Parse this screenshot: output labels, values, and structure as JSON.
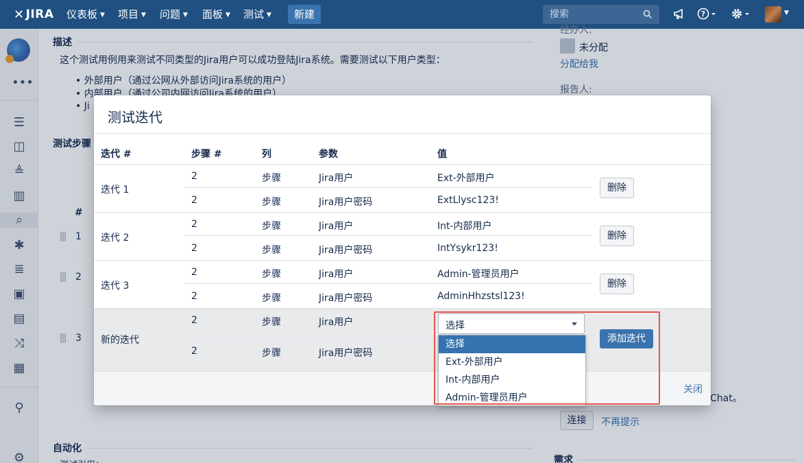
{
  "topnav": {
    "logo": "JIRA",
    "items": [
      {
        "label": "仪表板"
      },
      {
        "label": "项目"
      },
      {
        "label": "问题"
      },
      {
        "label": "面板"
      },
      {
        "label": "测试"
      }
    ],
    "create": "新建",
    "search_placeholder": "搜索"
  },
  "page": {
    "description_heading": "描述",
    "description_text": "这个测试用例用来测试不同类型的Jira用户可以成功登陆Jira系统。需要测试以下用户类型：",
    "bullets": [
      "外部用户（通过公网从外部访问Jira系统的用户）",
      "内部用户（通过公司内网访问Jira系统的用户）",
      "Ji"
    ],
    "test_steps_heading": "测试步骤",
    "step_col": "#",
    "step_rows": [
      "1",
      "2",
      "3"
    ],
    "automation_heading": "自动化",
    "test_ref": "测试引用：",
    "assignee_label": "经办人:",
    "assignee_value": "未分配",
    "assign_to_me": "分配给我",
    "reporter_label": "报告人:",
    "chat_text": "Chat。",
    "connect_btn": "连接",
    "no_more": "不再提示",
    "requirements": "需求"
  },
  "dialog": {
    "title": "测试迭代",
    "headers": {
      "iteration": "迭代 #",
      "step": "步骤 #",
      "column": "列",
      "param": "参数",
      "value": "值"
    },
    "iterations": [
      {
        "label": "迭代 1",
        "rows": [
          {
            "step": "2",
            "column": "步骤",
            "param": "Jira用户",
            "value": "Ext-外部用户"
          },
          {
            "step": "2",
            "column": "步骤",
            "param": "Jira用户密码",
            "value": "ExtLlysc123!"
          }
        ],
        "delete": "删除"
      },
      {
        "label": "迭代 2",
        "rows": [
          {
            "step": "2",
            "column": "步骤",
            "param": "Jira用户",
            "value": "Int-内部用户"
          },
          {
            "step": "2",
            "column": "步骤",
            "param": "Jira用户密码",
            "value": "IntYsykr123!"
          }
        ],
        "delete": "删除"
      },
      {
        "label": "迭代 3",
        "rows": [
          {
            "step": "2",
            "column": "步骤",
            "param": "Jira用户",
            "value": "Admin-管理员用户"
          },
          {
            "step": "2",
            "column": "步骤",
            "param": "Jira用户密码",
            "value": "AdminHhzstsl123!"
          }
        ],
        "delete": "删除"
      }
    ],
    "new_iteration": {
      "label": "新的迭代",
      "rows": [
        {
          "step": "2",
          "column": "步骤",
          "param": "Jira用户"
        },
        {
          "step": "2",
          "column": "步骤",
          "param": "Jira用户密码"
        }
      ],
      "select_value": "选择",
      "options": [
        "选择",
        "Ext-外部用户",
        "Int-内部用户",
        "Admin-管理员用户"
      ],
      "add_button": "添加迭代"
    },
    "close": "关闭"
  },
  "colors": {
    "nav_bg": "#205081",
    "primary": "#3b73af",
    "selected_option": "#3572b0",
    "highlight": "#e0594b"
  }
}
